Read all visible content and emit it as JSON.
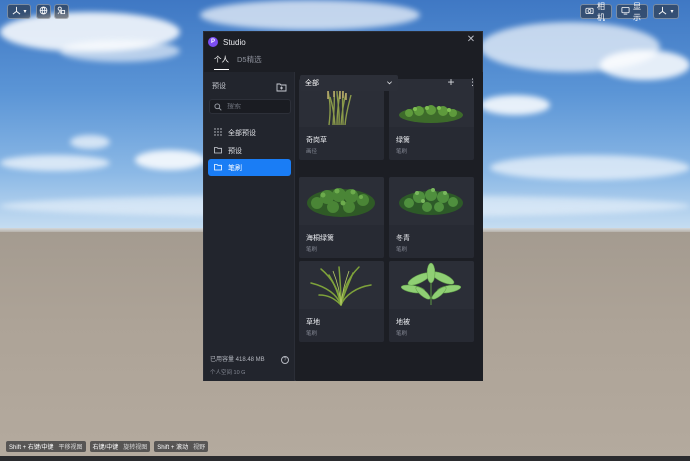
{
  "toolbar": {
    "left_icons": [
      "transform-icon",
      "globe-icon",
      "scene-icon"
    ],
    "camera_label": "相机",
    "display_label": "显示",
    "profile_icon": "user-icon"
  },
  "panel": {
    "title": "Studio",
    "logo_letter": "P",
    "tabs": [
      {
        "label": "个人",
        "active": true
      },
      {
        "label": "D5精选",
        "active": false
      }
    ]
  },
  "sidebar": {
    "heading": "预设",
    "search_placeholder": "搜索",
    "items": [
      {
        "label": "全部预设",
        "icon": "grid-icon",
        "active": false
      },
      {
        "label": "预设",
        "icon": "folder-icon",
        "active": false
      },
      {
        "label": "笔刷",
        "icon": "folder-icon",
        "active": true
      }
    ],
    "storage_used": "已用容量 418.48 MB",
    "storage_total": "个人空间 10 G"
  },
  "main": {
    "filter_value": "全部",
    "cards": [
      {
        "name": "奇岗草",
        "type": "画径",
        "thumb": "tall-grass"
      },
      {
        "name": "绿篱",
        "type": "笔刷",
        "thumb": "hedge-green"
      },
      {
        "name": "海桐绿篱",
        "type": "笔刷",
        "thumb": "hedge-dark"
      },
      {
        "name": "冬青",
        "type": "笔刷",
        "thumb": "holly"
      },
      {
        "name": "草地",
        "type": "笔刷",
        "thumb": "grass-clump"
      },
      {
        "name": "地被",
        "type": "笔刷",
        "thumb": "hosta"
      }
    ]
  },
  "hints": [
    {
      "keys": "Shift + 右键/中键",
      "desc": "平移视图"
    },
    {
      "keys": "右键/中键",
      "desc": "旋转视图"
    },
    {
      "keys": "Shift + 滚动",
      "desc": "视野"
    }
  ]
}
